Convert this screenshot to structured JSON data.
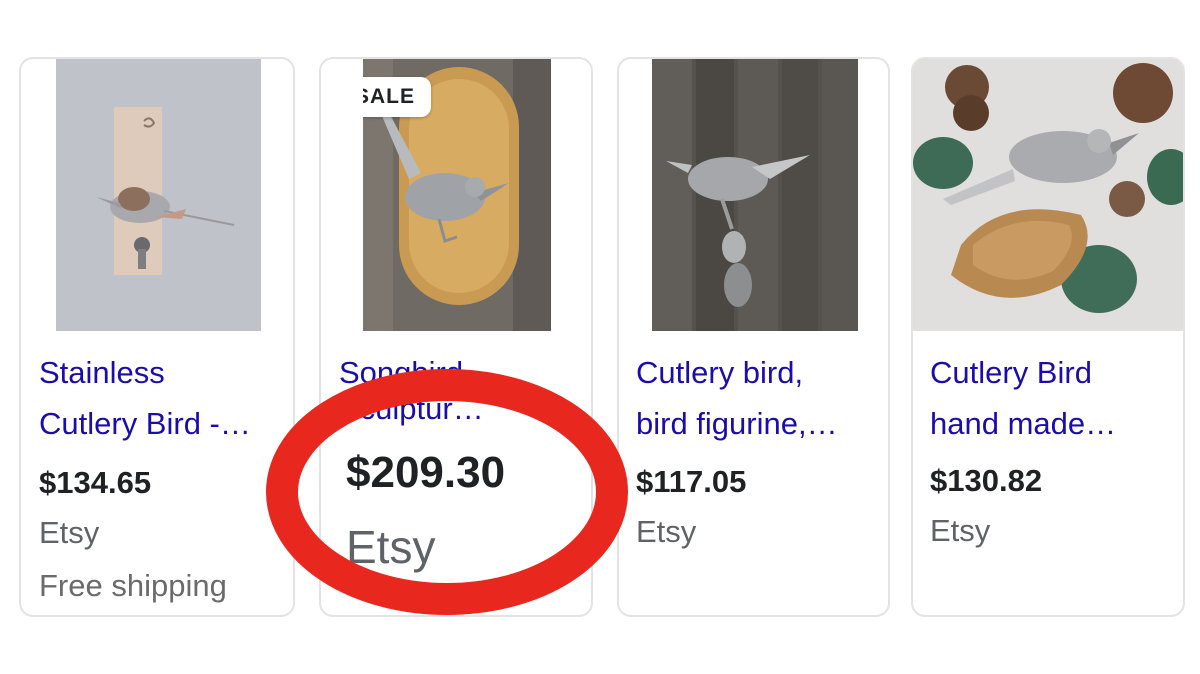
{
  "products": [
    {
      "title_line1": "Stainless",
      "title_line2": "Cutlery Bird -…",
      "price": "$134.65",
      "store": "Etsy",
      "shipping": "Free shipping"
    },
    {
      "badge": "SALE",
      "title_line1": "Songbird",
      "title_line2": "Sculptur…",
      "price": "$209.30",
      "store": "Etsy"
    },
    {
      "title_line1": "Cutlery bird,",
      "title_line2": "bird figurine,…",
      "price": "$117.05",
      "store": "Etsy"
    },
    {
      "title_line1": "Cutlery Bird",
      "title_line2": "hand made…",
      "price": "$130.82",
      "store": "Etsy"
    }
  ],
  "annotation": {
    "color": "#e8281e",
    "highlight": "red-circle-around-price"
  },
  "colors": {
    "link": "#1a0dab",
    "price": "#202124",
    "muted": "#5f6368",
    "border": "#e3e3e3"
  }
}
